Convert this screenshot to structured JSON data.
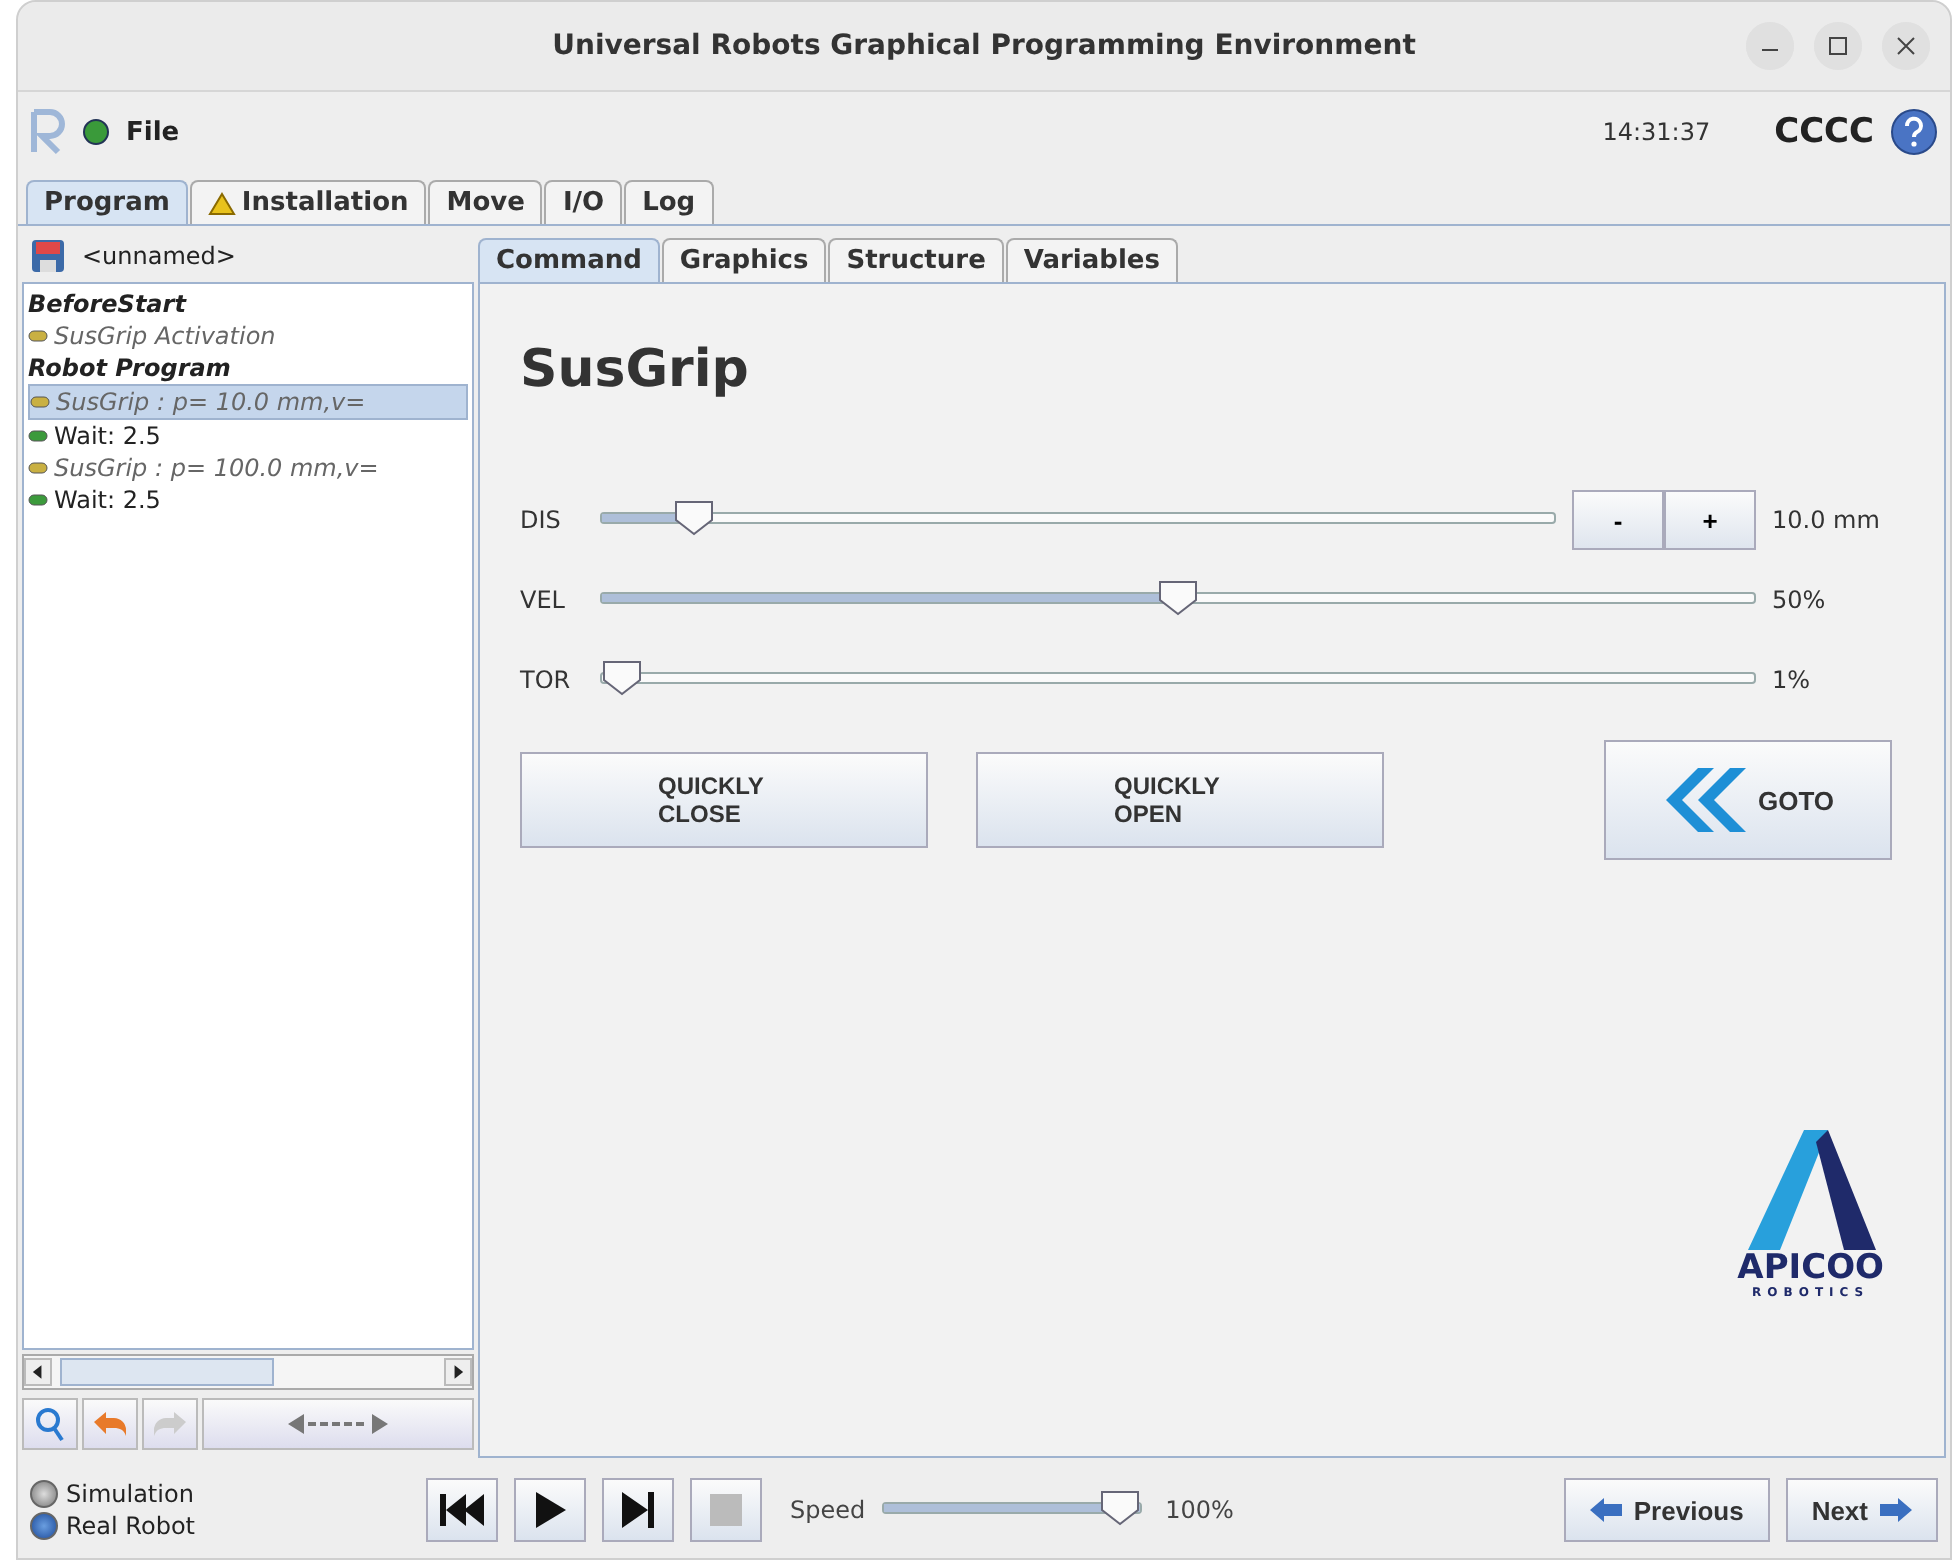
{
  "window": {
    "title": "Universal Robots Graphical Programming Environment"
  },
  "header": {
    "menu": "File",
    "time": "14:31:37",
    "robot_name": "CCCC"
  },
  "tabs": [
    {
      "label": "Program",
      "selected": true,
      "warning": false
    },
    {
      "label": "Installation",
      "selected": false,
      "warning": true
    },
    {
      "label": "Move",
      "selected": false,
      "warning": false
    },
    {
      "label": "I/O",
      "selected": false,
      "warning": false
    },
    {
      "label": "Log",
      "selected": false,
      "warning": false
    }
  ],
  "program_name": "<unnamed>",
  "tree": [
    {
      "label": "BeforeStart",
      "kind": "section",
      "selected": false,
      "children": [
        {
          "label": "SusGrip Activation",
          "kind": "gripper",
          "selected": false
        }
      ]
    },
    {
      "label": "Robot Program",
      "kind": "section",
      "selected": false,
      "children": [
        {
          "label": "SusGrip : p= 10.0 mm,v=",
          "kind": "gripper",
          "selected": true
        },
        {
          "label": "Wait: 2.5",
          "kind": "wait",
          "selected": false
        },
        {
          "label": "SusGrip : p= 100.0 mm,v=",
          "kind": "gripper",
          "selected": false
        },
        {
          "label": "Wait: 2.5",
          "kind": "wait",
          "selected": false
        }
      ]
    }
  ],
  "sub_tabs": [
    {
      "label": "Command",
      "selected": true
    },
    {
      "label": "Graphics",
      "selected": false
    },
    {
      "label": "Structure",
      "selected": false
    },
    {
      "label": "Variables",
      "selected": false
    }
  ],
  "command": {
    "title": "SusGrip",
    "sliders": [
      {
        "label": "DIS",
        "level": 0.08,
        "reading": "10.0 mm",
        "stepper": true
      },
      {
        "label": "VEL",
        "level": 0.5,
        "reading": "50%",
        "stepper": false
      },
      {
        "label": "TOR",
        "level": 0.0,
        "reading": "1%",
        "stepper": false
      }
    ],
    "stepper_buttons": [
      "-",
      "+"
    ],
    "buttons": [
      "QUICKLY\nCLOSE",
      "QUICKLY\nOPEN"
    ],
    "goto": "GOTO",
    "logo": {
      "name": "APICOO",
      "tagline": "ROBOTICS"
    }
  },
  "modes": [
    {
      "label": "Simulation",
      "selected": false
    },
    {
      "label": "Real Robot",
      "selected": true
    }
  ],
  "speed": {
    "label": "Speed",
    "level": 1.0,
    "reading": "100%"
  },
  "nav": {
    "previous": "Previous",
    "next": "Next"
  }
}
